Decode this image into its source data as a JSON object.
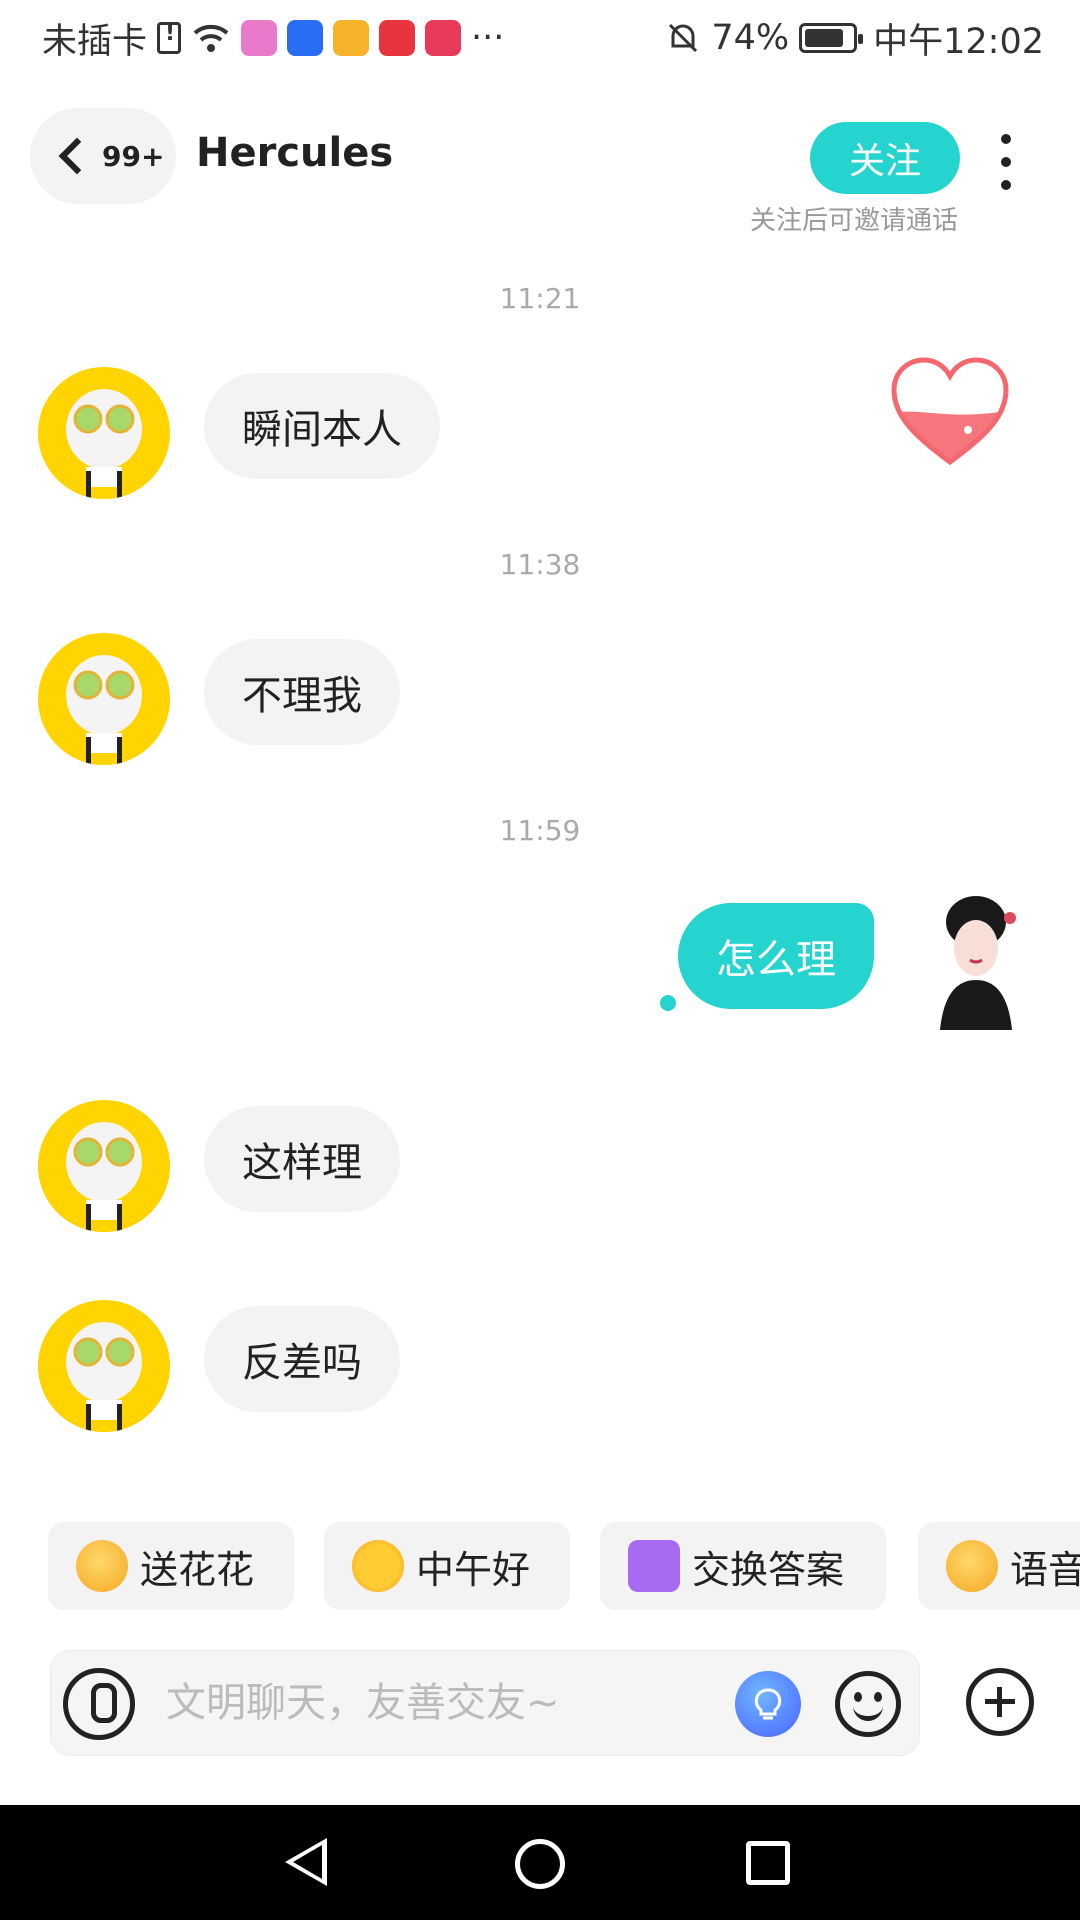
{
  "status_bar": {
    "carrier": "未插卡",
    "more": "···",
    "battery": "74%",
    "time": "中午12:02"
  },
  "header": {
    "unread": "99+",
    "name": "Hercules",
    "follow_label": "关注",
    "follow_hint": "关注后可邀请通话"
  },
  "messages": [
    {
      "time": "11:21",
      "text": "瞬间本人",
      "side": "in"
    },
    {
      "time": "11:38",
      "text": "不理我",
      "side": "in"
    },
    {
      "time": "11:59",
      "text": "怎么理",
      "side": "out"
    },
    {
      "text": "这样理",
      "side": "in"
    },
    {
      "text": "反差吗",
      "side": "in"
    }
  ],
  "quick_replies": [
    {
      "label": "送花花",
      "icon": "flower-emoji-icon"
    },
    {
      "label": "中午好",
      "icon": "sun-sunglasses-icon"
    },
    {
      "label": "交换答案",
      "icon": "exchange-icon"
    },
    {
      "label": "语音",
      "icon": "voice-emoji-icon"
    }
  ],
  "input": {
    "placeholder": "文明聊天，友善交友~"
  },
  "colors": {
    "accent": "#26d4cf",
    "bubble_in": "#f3f3f3",
    "avatar_bg": "#ffd400",
    "heart": "#f4676e"
  }
}
